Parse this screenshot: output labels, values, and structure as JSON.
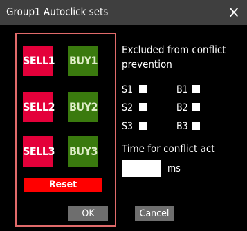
{
  "window": {
    "title": "Group1 Autoclick sets",
    "close_glyph": "×"
  },
  "left_panel": {
    "sell_buttons": [
      "SELL1",
      "SELL2",
      "SELL3"
    ],
    "buy_buttons": [
      "BUY1",
      "BUY2",
      "BUY3"
    ],
    "reset_label": "Reset"
  },
  "right_panel": {
    "excluded_heading_line1": "Excluded from conflict",
    "excluded_heading_line2": "prevention",
    "checkboxes": [
      {
        "label": "S1",
        "checked": false
      },
      {
        "label": "S2",
        "checked": false
      },
      {
        "label": "S3",
        "checked": false
      },
      {
        "label": "B1",
        "checked": false
      },
      {
        "label": "B2",
        "checked": false
      },
      {
        "label": "B3",
        "checked": false
      }
    ],
    "time_heading": "Time for conflict act",
    "ms_value": "",
    "ms_unit": "ms"
  },
  "footer": {
    "ok_label": "OK",
    "cancel_label": "Cancel"
  },
  "colors": {
    "sell": "#e4003a",
    "buy": "#3a7a0e",
    "reset": "#ff0000",
    "panel_border": "#e06a6a"
  }
}
